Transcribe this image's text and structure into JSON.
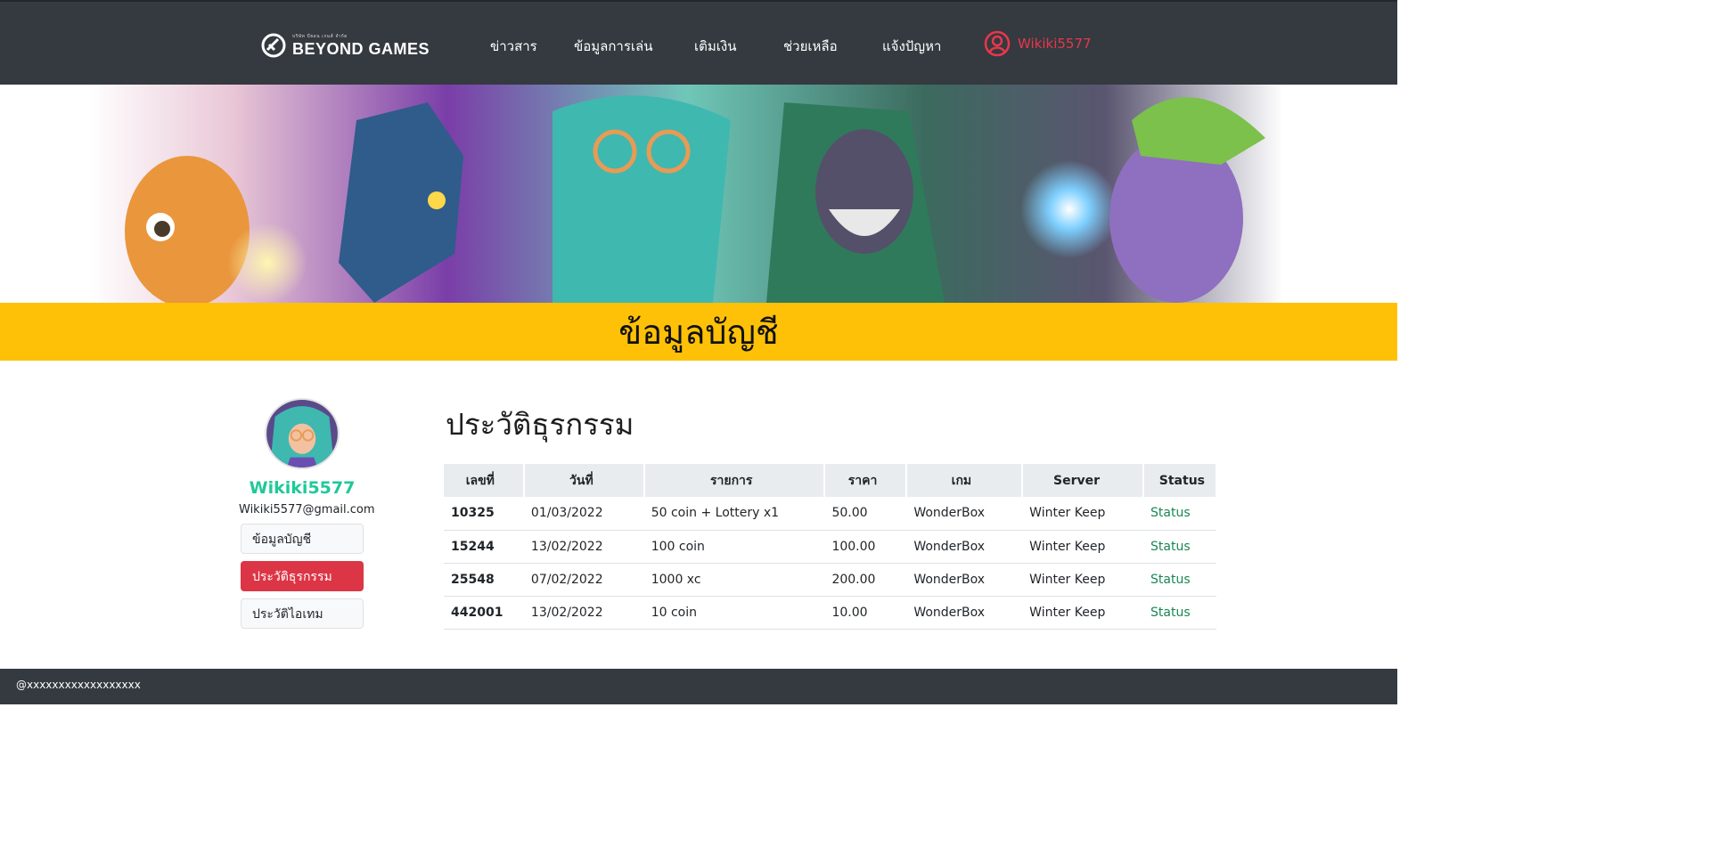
{
  "header": {
    "logo_small": "บริษัท บียอน เกมส์ จำกัด",
    "logo_text": "BEYOND GAMES",
    "nav": [
      "ข่าวสาร",
      "ข้อมูลการเล่น",
      "เติมเงิน",
      "ช่วยเหลือ",
      "แจ้งปัญหา"
    ],
    "user": "Wikiki5577"
  },
  "page_title": "ข้อมูลบัญชี",
  "profile": {
    "username": "Wikiki5577",
    "email": "Wikiki5577@gmail.com",
    "menu": [
      "ข้อมูลบัญชี",
      "ประวัติธุรกรรม",
      "ประวัติไอเทม"
    ]
  },
  "transactions": {
    "heading": "ประวัติธุรกรรม",
    "columns": [
      "เลขที่",
      "วันที่",
      "รายการ",
      "ราคา",
      "เกม",
      "Server",
      "Status"
    ],
    "rows": [
      [
        "10325",
        "01/03/2022",
        "50 coin + Lottery x1",
        "50.00",
        "WonderBox",
        "Winter Keep",
        "Status"
      ],
      [
        "15244",
        "13/02/2022",
        "100 coin",
        "100.00",
        "WonderBox",
        "Winter Keep",
        "Status"
      ],
      [
        "25548",
        "07/02/2022",
        "1000 xc",
        "200.00",
        "WonderBox",
        "Winter Keep",
        "Status"
      ],
      [
        "442001",
        "13/02/2022",
        "10 coin",
        "10.00",
        "WonderBox",
        "Winter Keep",
        "Status"
      ]
    ]
  },
  "footer": "@xxxxxxxxxxxxxxxxxx",
  "colors": {
    "navbar": "#343a40",
    "accent_yellow": "#ffc107",
    "accent_red": "#dc3545",
    "username_teal": "#20c997",
    "status_green": "#198754"
  }
}
